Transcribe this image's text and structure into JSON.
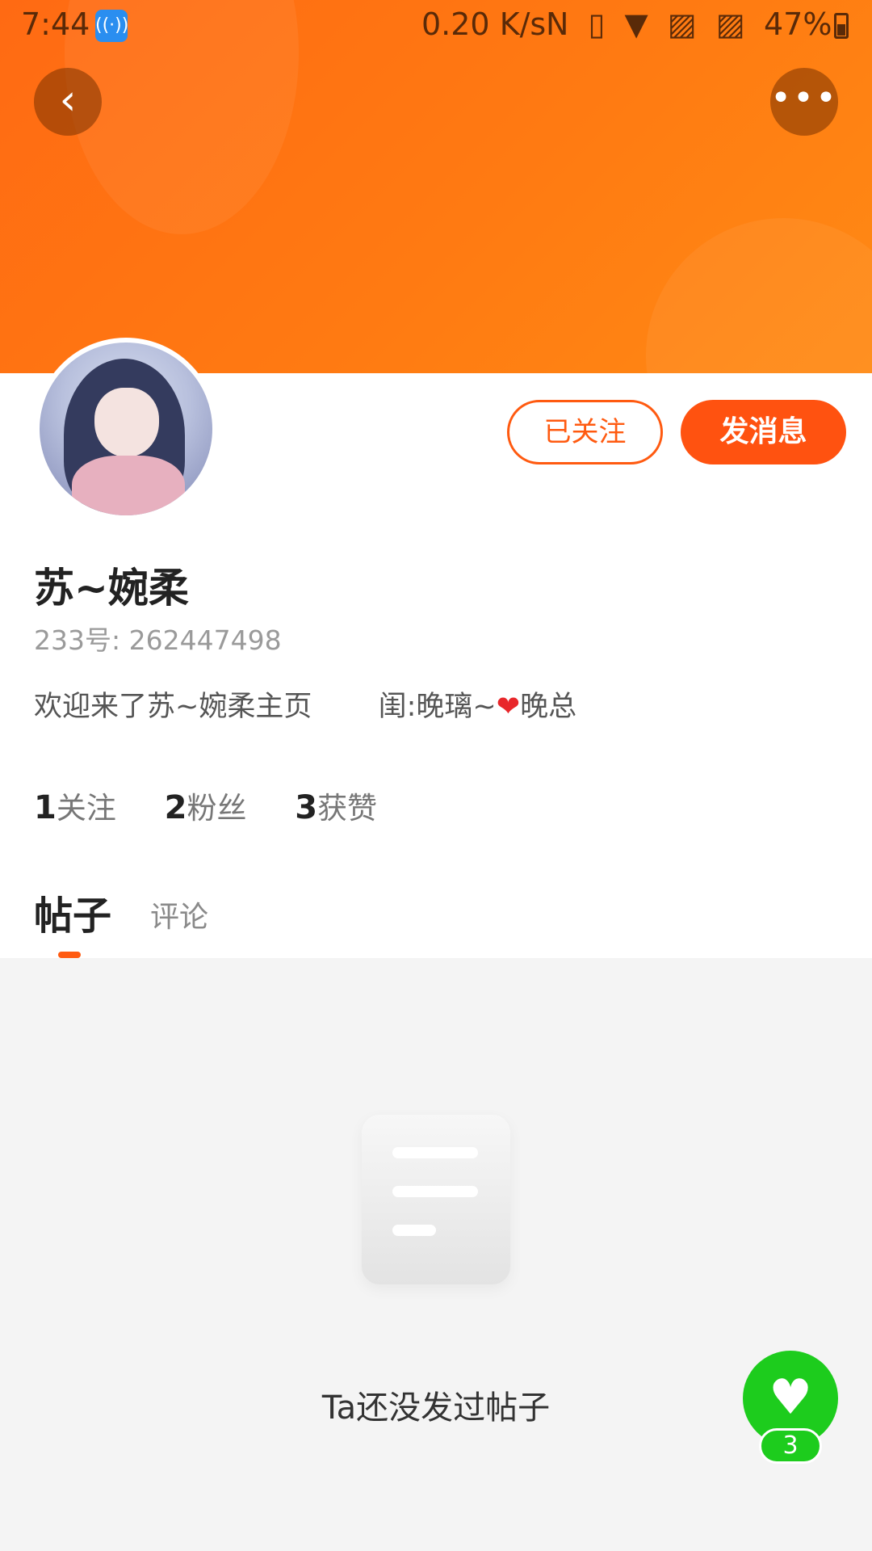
{
  "status_bar": {
    "time": "7:44",
    "speed": "0.20 K/s",
    "icons": "N ▯ ▼ ▨ ▨",
    "battery": "47%"
  },
  "header": {
    "back_icon": "chevron-left-icon",
    "more_icon": "more-dots-icon",
    "back_glyph": "‹",
    "more_glyph": "•••"
  },
  "profile": {
    "follow_button": "已关注",
    "message_button": "发消息",
    "username": "苏~婉柔",
    "uid_label": "233号:",
    "uid_value": "262447498",
    "bio_part1": "欢迎来了苏~婉柔主页",
    "bio_part2": "闺:晚璃~",
    "bio_heart": "❤",
    "bio_part3": "晚总",
    "stats": [
      {
        "num": "1",
        "label": "关注"
      },
      {
        "num": "2",
        "label": "粉丝"
      },
      {
        "num": "3",
        "label": "获赞"
      }
    ]
  },
  "tabs": {
    "posts": "帖子",
    "comments": "评论"
  },
  "content": {
    "empty_text": "Ta还没发过帖子"
  },
  "like_fab": {
    "icon": "heart-icon",
    "glyph": "♥",
    "count": "3"
  },
  "colors": {
    "brand_orange": "#ff5a10",
    "like_green": "#1dcc1d"
  }
}
